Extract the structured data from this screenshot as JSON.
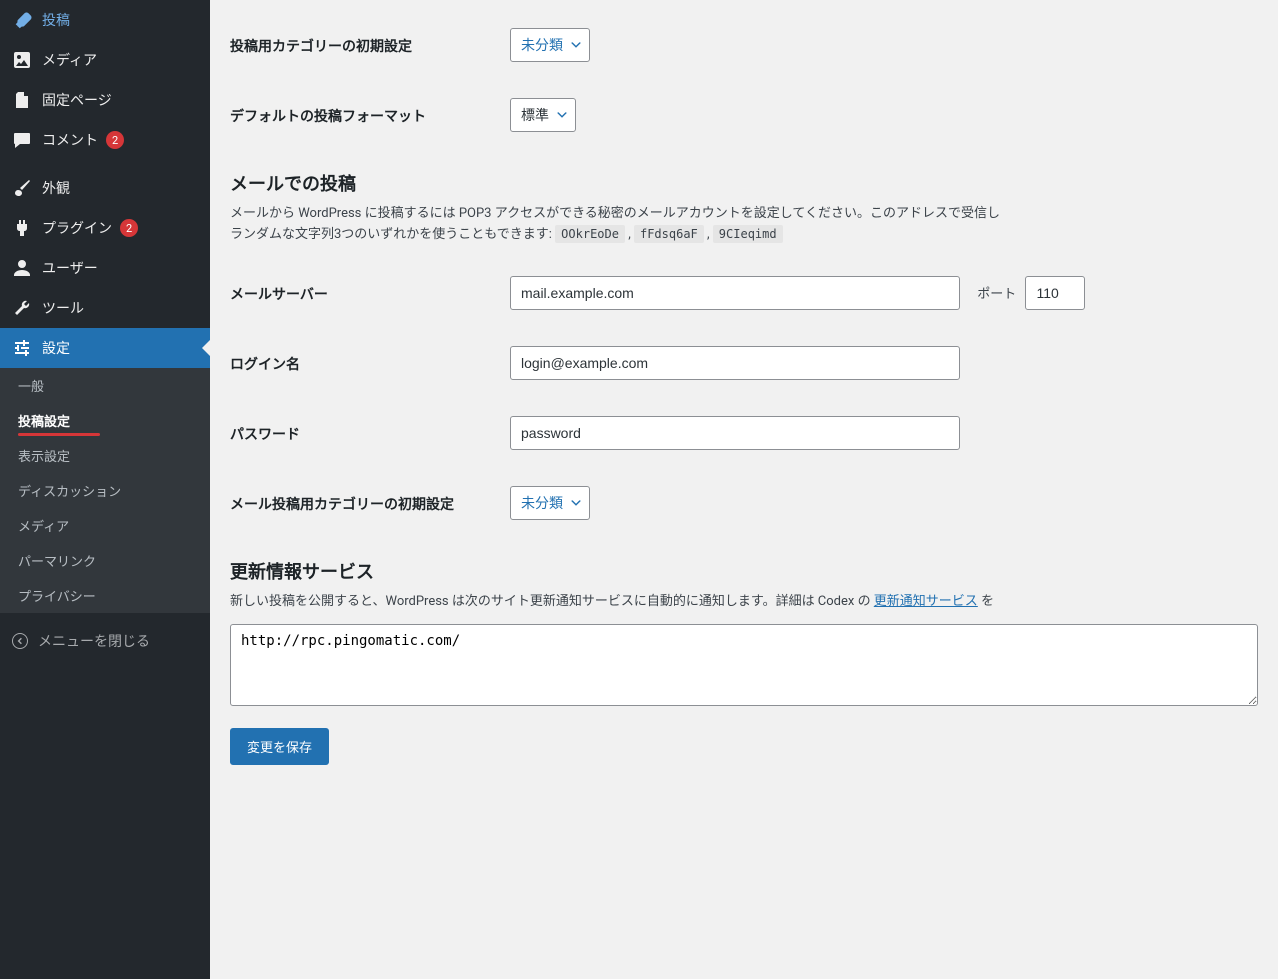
{
  "sidebar": {
    "posts": "投稿",
    "media": "メディア",
    "pages": "固定ページ",
    "comments": "コメント",
    "comments_count": "2",
    "appearance": "外観",
    "plugins": "プラグイン",
    "plugins_count": "2",
    "users": "ユーザー",
    "tools": "ツール",
    "settings": "設定",
    "submenu": {
      "general": "一般",
      "writing": "投稿設定",
      "reading": "表示設定",
      "discussion": "ディスカッション",
      "media": "メディア",
      "permalink": "パーマリンク",
      "privacy": "プライバシー"
    },
    "collapse": "メニューを閉じる"
  },
  "form": {
    "default_category_label": "投稿用カテゴリーの初期設定",
    "default_category_value": "未分類",
    "default_format_label": "デフォルトの投稿フォーマット",
    "default_format_value": "標準",
    "mail_heading": "メールでの投稿",
    "mail_desc_a": "メールから WordPress に投稿するには POP3 アクセスができる秘密のメールアカウントを設定してください。このアドレスで受信し",
    "mail_desc_b": "ランダムな文字列3つのいずれかを使うこともできます: ",
    "rand1": "OOkrEoDe",
    "rand2": "fFdsq6aF",
    "rand3": "9CIeqimd",
    "mail_server_label": "メールサーバー",
    "mail_server_value": "mail.example.com",
    "port_label": "ポート",
    "port_value": "110",
    "login_label": "ログイン名",
    "login_value": "login@example.com",
    "password_label": "パスワード",
    "password_value": "password",
    "mail_category_label": "メール投稿用カテゴリーの初期設定",
    "mail_category_value": "未分類",
    "update_heading": "更新情報サービス",
    "update_desc_a": "新しい投稿を公開すると、WordPress は次のサイト更新通知サービスに自動的に通知します。詳細は Codex の ",
    "update_link": "更新通知サービス",
    "update_desc_b": " を",
    "ping_value": "http://rpc.pingomatic.com/",
    "save": "変更を保存"
  }
}
